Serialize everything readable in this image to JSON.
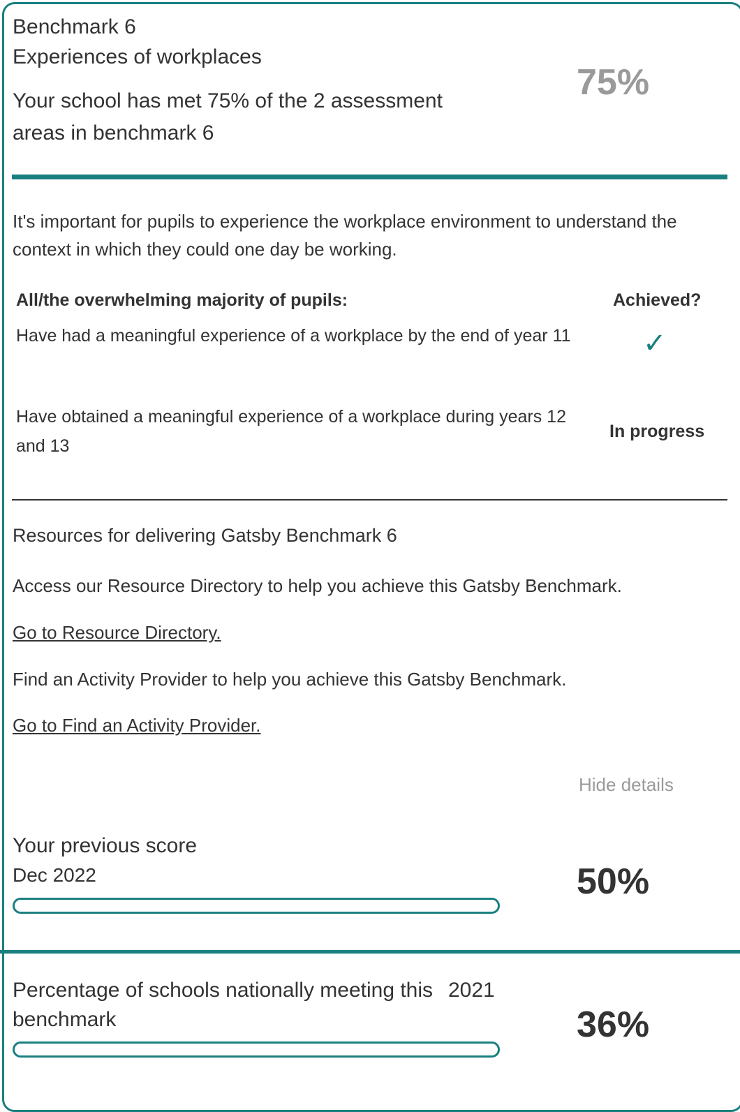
{
  "colors": {
    "accent": "#19807f",
    "text": "#333333",
    "muted": "#9a9a9a"
  },
  "header": {
    "benchmark": "Benchmark 6",
    "subtitle": "Experiences of workplaces",
    "summary": "Your school has met 75% of the 2 assessment areas in benchmark 6",
    "score": "75%",
    "score_fraction": 0.75
  },
  "intro": "It's important for pupils to experience the workplace environment to understand the context in which they could one day be working.",
  "criteria": {
    "heading": "All/the overwhelming majority of pupils:",
    "status_heading": "Achieved?",
    "rows": [
      {
        "text": "Have had a meaningful experience of a workplace by the end of year 11",
        "status_icon": "check-icon",
        "status": "✓"
      },
      {
        "text": "Have obtained a meaningful experience of a workplace during years 12 and 13",
        "status": "In progress"
      }
    ]
  },
  "resources": {
    "title": "Resources for delivering Gatsby Benchmark 6",
    "directory_text": "Access our Resource Directory to help you achieve this Gatsby Benchmark.",
    "directory_link": "Go to Resource Directory.",
    "provider_text": "Find an Activity Provider to help you achieve this Gatsby Benchmark.",
    "provider_link": "Go to Find an Activity Provider."
  },
  "toggle_label": "Hide details",
  "previous": {
    "label": "Your previous score",
    "date": "Dec 2022",
    "score": "50%",
    "score_fraction": 0.5
  },
  "national": {
    "label": "Percentage of schools nationally meeting this benchmark",
    "year": "2021",
    "score": "36%",
    "score_fraction": 0.36
  }
}
